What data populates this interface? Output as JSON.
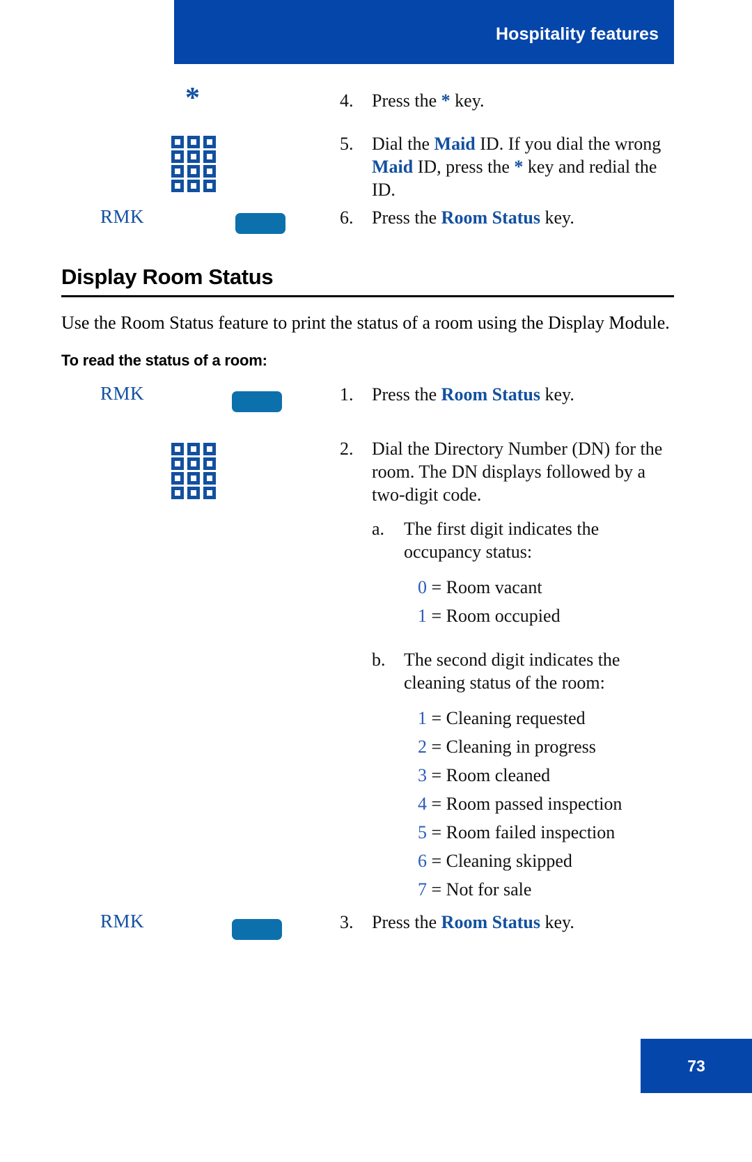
{
  "header": {
    "title": "Hospitality features"
  },
  "top_procedure": {
    "steps": [
      {
        "number": "4.",
        "icon": "star-key-icon",
        "segments": [
          {
            "text": "Press the ",
            "style": "plain"
          },
          {
            "text": "*",
            "style": "blue"
          },
          {
            "text": " key.",
            "style": "plain"
          }
        ]
      },
      {
        "number": "5.",
        "icon": "keypad-icon",
        "segments": [
          {
            "text": "Dial the ",
            "style": "plain"
          },
          {
            "text": "Maid",
            "style": "blue-bold"
          },
          {
            "text": " ID. If you dial the wrong ",
            "style": "plain"
          },
          {
            "text": "Maid",
            "style": "blue-bold"
          },
          {
            "text": " ID, press the ",
            "style": "plain"
          },
          {
            "text": "*",
            "style": "blue"
          },
          {
            "text": " key and redial the ID.",
            "style": "plain"
          }
        ]
      },
      {
        "number": "6.",
        "icon": "rmk-key-icon",
        "icon_label": "RMK",
        "segments": [
          {
            "text": "Press the ",
            "style": "plain"
          },
          {
            "text": "Room Status",
            "style": "blue-bold"
          },
          {
            "text": " key.",
            "style": "plain"
          }
        ]
      }
    ]
  },
  "section": {
    "heading": "Display Room Status",
    "intro": "Use the Room Status feature to print the status of a room using the Display Module.",
    "sub_heading": "To read the status of a room:"
  },
  "read_procedure": {
    "step1": {
      "number": "1.",
      "icon_label": "RMK",
      "segments": [
        {
          "text": "Press the ",
          "style": "plain"
        },
        {
          "text": "Room Status",
          "style": "blue-bold"
        },
        {
          "text": " key.",
          "style": "plain"
        }
      ]
    },
    "step2": {
      "number": "2.",
      "text": "Dial the Directory Number (DN) for the room. The DN displays followed by a two-digit code."
    },
    "sub_a": {
      "letter": "a.",
      "text": "The first digit indicates the occupancy status:"
    },
    "occupancy_codes": [
      {
        "digit": "0",
        "desc": "= Room vacant"
      },
      {
        "digit": "1",
        "desc": "= Room occupied"
      }
    ],
    "sub_b": {
      "letter": "b.",
      "text": "The second digit indicates the cleaning status of the room:"
    },
    "cleaning_codes": [
      {
        "digit": "1",
        "desc": "= Cleaning requested"
      },
      {
        "digit": "2",
        "desc": "= Cleaning in progress"
      },
      {
        "digit": "3",
        "desc": "= Room cleaned"
      },
      {
        "digit": "4",
        "desc": "= Room passed inspection"
      },
      {
        "digit": "5",
        "desc": "= Room failed inspection"
      },
      {
        "digit": "6",
        "desc": "= Cleaning skipped"
      },
      {
        "digit": "7",
        "desc": "= Not for sale"
      }
    ],
    "step3": {
      "number": "3.",
      "icon_label": "RMK",
      "segments": [
        {
          "text": "Press the ",
          "style": "plain"
        },
        {
          "text": "Room Status",
          "style": "blue-bold"
        },
        {
          "text": " key.",
          "style": "plain"
        }
      ]
    }
  },
  "footer": {
    "page_number": "73"
  }
}
